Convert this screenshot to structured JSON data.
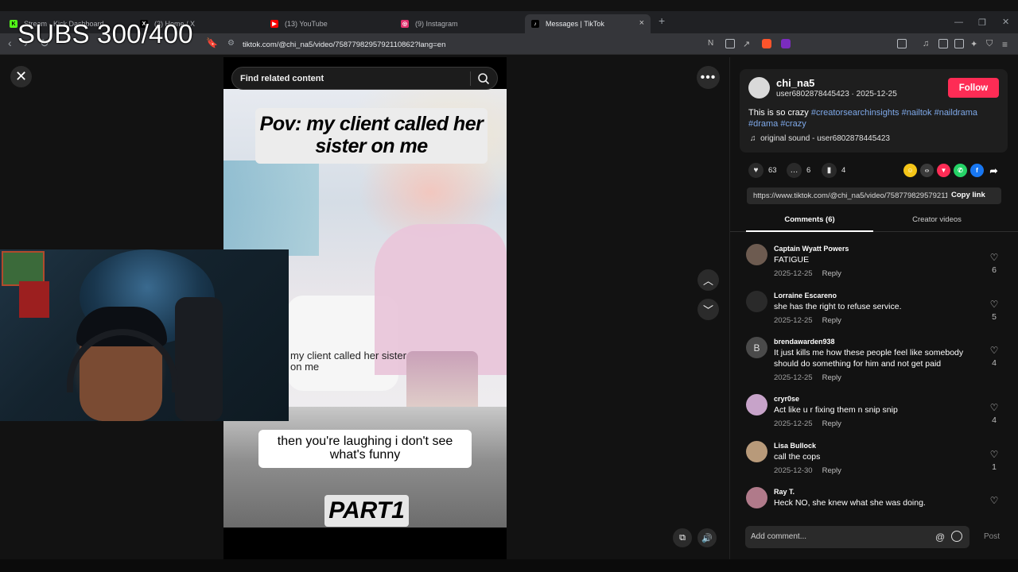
{
  "overlay": {
    "subs_text": "SUBS 300/400"
  },
  "browser": {
    "tabs": [
      {
        "title": "Stream - Kick Dashboard",
        "favicon": "kick-icon",
        "color": "#53fc18",
        "active": false
      },
      {
        "title": "(3) Home / X",
        "favicon": "x-icon",
        "color": "#000000",
        "active": false
      },
      {
        "title": "(13) YouTube",
        "favicon": "youtube-icon",
        "color": "#ff0000",
        "active": false
      },
      {
        "title": "(9) Instagram",
        "favicon": "instagram-icon",
        "color": "#e1306c",
        "active": false
      },
      {
        "title": "Messages | TikTok",
        "favicon": "tiktok-icon",
        "color": "#000000",
        "active": true
      }
    ],
    "url": "tiktok.com/@chi_na5/video/7587798295792110862?lang=en"
  },
  "video": {
    "search_placeholder": "Find related content",
    "caption_top": "Pov: my client called her sister on me",
    "caption_inner": "my client called her sister on me",
    "caption_bottom": "then you're laughing i don't see what's funny",
    "part_label": "PART1"
  },
  "post": {
    "username": "chi_na5",
    "user_handle": "user6802878445423",
    "date": "2025-12-25",
    "follow_label": "Follow",
    "description_text": "This is so crazy",
    "hashtags": [
      "#creatorsearchinsights",
      "#nailtok",
      "#naildrama",
      "#drama",
      "#crazy"
    ],
    "sound": "original sound - user6802878445423",
    "likes": "63",
    "comments_count": "6",
    "saves": "4",
    "link": "https://www.tiktok.com/@chi_na5/video/7587798295792110862",
    "copy_link_label": "Copy link",
    "accent_color": "#fe2c55"
  },
  "tabs": {
    "comments": "Comments (6)",
    "creator_videos": "Creator videos"
  },
  "comments": [
    {
      "user": "Captain Wyatt Powers",
      "text": "FATIGUE",
      "date": "2025-12-25",
      "reply": "Reply",
      "likes": "6"
    },
    {
      "user": "Lorraine Escareno",
      "text": "she has the right to refuse service.",
      "date": "2025-12-25",
      "reply": "Reply",
      "likes": "5"
    },
    {
      "user": "brendawarden938",
      "text": "It just kills me how these people feel like somebody should do something for him and not get paid",
      "date": "2025-12-25",
      "reply": "Reply",
      "likes": "4",
      "avatar_letter": "B"
    },
    {
      "user": "cryr0se",
      "text": "Act like u r fixing them n snip snip",
      "date": "2025-12-25",
      "reply": "Reply",
      "likes": "4"
    },
    {
      "user": "Lisa Bullock",
      "text": "call the cops",
      "date": "2025-12-30",
      "reply": "Reply",
      "likes": "1"
    },
    {
      "user": "Ray T.",
      "text": "Heck NO, she knew what she was doing.",
      "date": "",
      "reply": "",
      "likes": ""
    }
  ],
  "composer": {
    "placeholder": "Add comment...",
    "post_label": "Post"
  }
}
